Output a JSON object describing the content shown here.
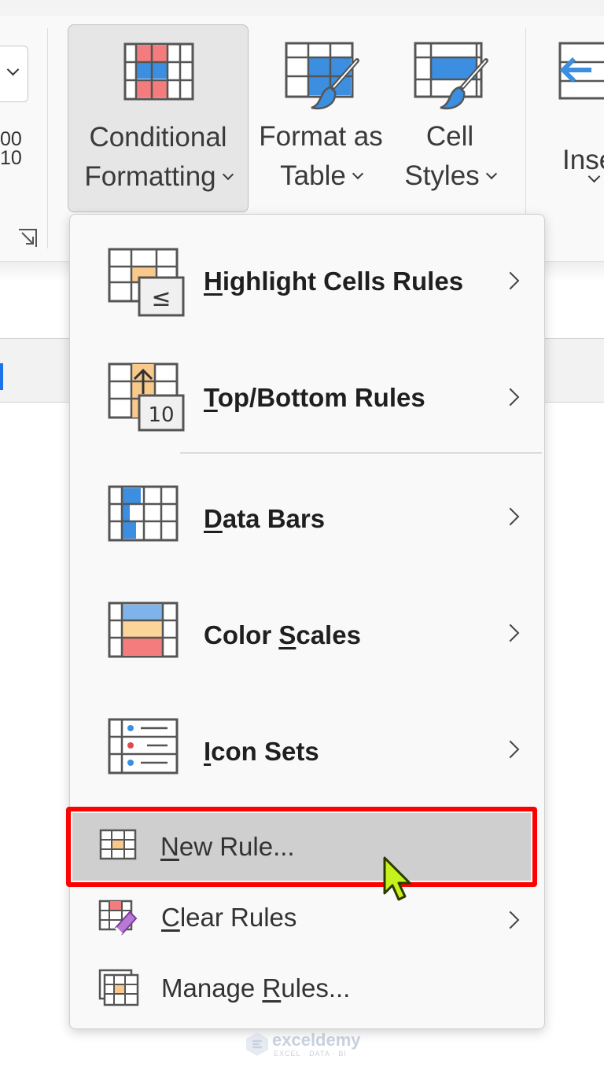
{
  "ribbon": {
    "left_numbers": [
      "00",
      "10"
    ],
    "conditional_formatting": {
      "line1": "Conditional",
      "line2": "Formatting"
    },
    "format_as_table": {
      "line1": "Format as",
      "line2": "Table"
    },
    "cell_styles": {
      "line1": "Cell",
      "line2": "Styles"
    },
    "insert": {
      "line1": "Inse"
    }
  },
  "menu": {
    "items": [
      {
        "pre": "",
        "u": "H",
        "post": "ighlight Cells Rules"
      },
      {
        "pre": "",
        "u": "T",
        "post": "op/Bottom Rules",
        "badge": "10"
      },
      {
        "pre": "",
        "u": "D",
        "post": "ata Bars"
      },
      {
        "pre": "Color ",
        "u": "S",
        "post": "cales"
      },
      {
        "pre": "",
        "u": "I",
        "post": "con Sets"
      }
    ],
    "highlight_badge": "≤",
    "new_rule": {
      "pre": "",
      "u": "N",
      "post": "ew Rule..."
    },
    "clear_rules": {
      "pre": "",
      "u": "C",
      "post": "lear Rules"
    },
    "manage_rules": {
      "pre": "Manage ",
      "u": "R",
      "post": "ules..."
    }
  },
  "watermark": {
    "brand": "exceldemy",
    "tagline": "EXCEL · DATA · BI"
  },
  "colors": {
    "highlight": "#ff0000",
    "accent_blue": "#3b8ee0",
    "accent_red": "#f47c7c",
    "accent_orange": "#f9c98c",
    "cursor": "#c6f11c"
  }
}
